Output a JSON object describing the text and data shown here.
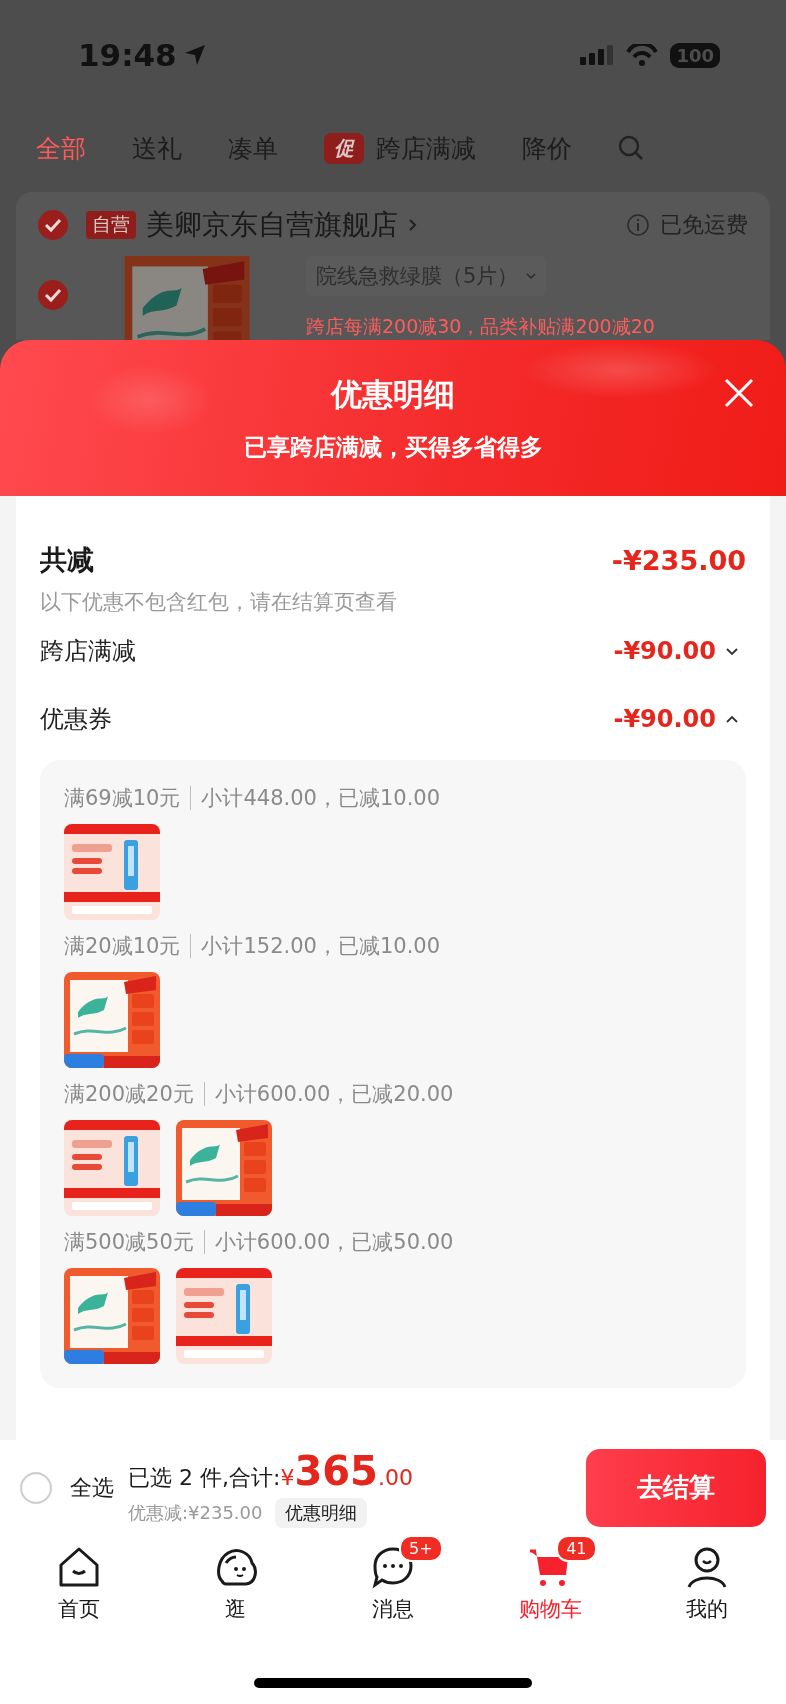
{
  "status_bar": {
    "time": "19:48",
    "battery": "100"
  },
  "filter_tabs": [
    {
      "label": "全部",
      "selected": true
    },
    {
      "label": "送礼",
      "selected": false
    },
    {
      "label": "凑单",
      "selected": false
    },
    {
      "label": "跨店满减",
      "badge": "促",
      "selected": false
    },
    {
      "label": "降价",
      "selected": false
    }
  ],
  "store": {
    "checked": true,
    "tag": "自营",
    "name": "美卿京东自营旗舰店",
    "shipping": "已免运费"
  },
  "product": {
    "checked": true,
    "variant": "院线急救绿膜（5片）",
    "promo": "跨店每满200减30，品类补贴满200减20"
  },
  "sheet": {
    "title": "优惠明细",
    "subtitle": "已享跨店满减，买得多省得多"
  },
  "summary": {
    "label": "共减",
    "amount": "-¥235.00",
    "note": "以下优惠不包含红包，请在结算页查看"
  },
  "discounts": [
    {
      "label": "跨店满减",
      "amount": "-¥90.00",
      "expanded": false
    },
    {
      "label": "优惠券",
      "amount": "-¥90.00",
      "expanded": true,
      "groups": [
        {
          "rule": "满69减10元",
          "detail": "小计448.00，已减10.00"
        },
        {
          "rule": "满20减10元",
          "detail": "小计152.00，已减10.00"
        },
        {
          "rule": "满200减20元",
          "detail": "小计600.00，已减20.00"
        },
        {
          "rule": "满500减50元",
          "detail": "小计600.00，已减50.00"
        }
      ]
    }
  ],
  "checkout_bar": {
    "select_all": {
      "label": "全选",
      "checked": false
    },
    "selected_text": "已选 2 件,合计:",
    "total": "¥365.00",
    "discount_text": "优惠减:¥235.00",
    "detail_button": "优惠明细",
    "checkout_button": "去结算"
  },
  "bottom_nav": [
    {
      "label": "首页",
      "kind": "home",
      "selected": false
    },
    {
      "label": "逛",
      "kind": "browse",
      "selected": false
    },
    {
      "label": "消息",
      "kind": "message",
      "badge": "5+",
      "selected": false
    },
    {
      "label": "购物车",
      "kind": "cart",
      "badge": "41",
      "selected": true
    },
    {
      "label": "我的",
      "kind": "profile",
      "selected": false
    }
  ]
}
